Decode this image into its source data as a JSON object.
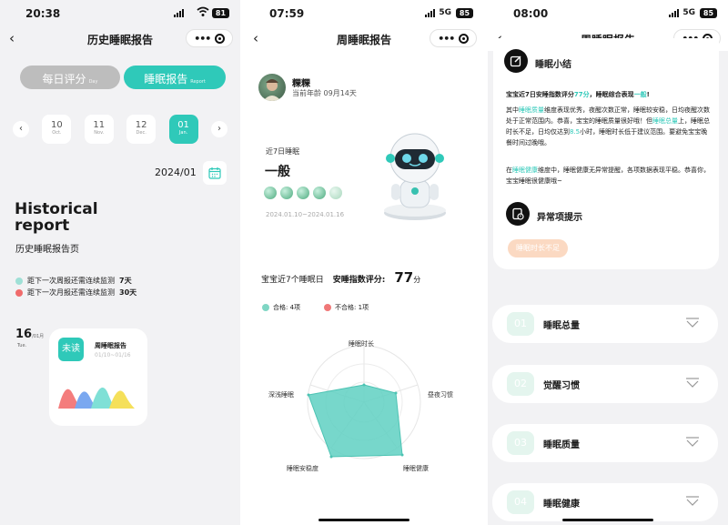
{
  "colors": {
    "accent": "#2fc9b9",
    "fail": "#f06b6b",
    "tab_inactive": "#bdbdbd",
    "warn_chip": "#fbd9c2"
  },
  "screen1": {
    "status": {
      "time": "20:38",
      "battery": "81"
    },
    "nav_title": "历史睡眠报告",
    "tabs": [
      {
        "label": "每日评分",
        "sub": "Day",
        "active": false
      },
      {
        "label": "睡眠报告",
        "sub": "Report",
        "active": true
      }
    ],
    "months": [
      {
        "num": "10",
        "abbr": "Oct."
      },
      {
        "num": "11",
        "abbr": "Nov."
      },
      {
        "num": "12",
        "abbr": "Dec."
      },
      {
        "num": "01",
        "abbr": "Jan."
      }
    ],
    "current_date": "2024/01",
    "title_en": "Historical report",
    "subtitle": "历史睡眠报告页",
    "legend": [
      {
        "text": "距下一次周报还需连续监测",
        "count": "7天"
      },
      {
        "text": "距下一次月报还需连续监测",
        "count": "30天"
      }
    ],
    "report_day": {
      "day": "16",
      "month": "/01月",
      "weekday": "Tue."
    },
    "report_card": {
      "badge": "未读",
      "title": "周睡眠报告",
      "range": "01/10~01/16"
    }
  },
  "screen2": {
    "status": {
      "time": "07:59",
      "network": "5G",
      "battery": "85"
    },
    "nav_title": "周睡眠报告",
    "user": {
      "name": "粿粿",
      "age": "当前年龄 09月14天"
    },
    "recent_label": "近7日睡眠",
    "verdict": "一般",
    "date_range": "2024.01.10~2024.01.16",
    "score": {
      "label": "宝宝近7个睡眠日",
      "name": "安睡指数评分:",
      "value": "77",
      "unit": "分"
    },
    "pass_fail": [
      {
        "label": "合格: 4项",
        "color": "#2fc9b9"
      },
      {
        "label": "不合格: 1项",
        "color": "#f06b6b"
      }
    ],
    "radar_labels": [
      "睡眠时长",
      "昼夜习惯",
      "睡眠健康",
      "睡眠安稳度",
      "深浅睡眠"
    ]
  },
  "screen3": {
    "status": {
      "time": "08:00",
      "network": "5G",
      "battery": "85"
    },
    "nav_title": "周睡眠报告",
    "summary_title": "睡眠小结",
    "summary_lead_a": "宝宝近7日安睡指数评分",
    "summary_lead_score": "77分",
    "summary_lead_b": "，睡眠综合表现",
    "summary_lead_level": "一般",
    "summary_lead_c": "!",
    "summary_p1_a": "其中",
    "summary_p1_hl1": "睡眠质量",
    "summary_p1_b": "维度表现优秀，夜醒次数正常，睡眠较安稳，日均夜醒次数处于正常范围内。恭喜，宝宝的睡眠质量很好哦！但",
    "summary_p1_hl2": "睡眠总量",
    "summary_p1_c": "上，睡眠总时长不足，日均仅达到",
    "summary_p1_hl3": "8.5",
    "summary_p1_d": "小时，睡眠时长低于建议范围。要避免宝宝晚餐时间过晚哦。",
    "summary_p2_a": "在",
    "summary_p2_hl": "睡眠健康",
    "summary_p2_b": "维度中，睡眠健康无异常提醒，各项数据表现平稳。恭喜你，宝宝睡眠很健康哦~",
    "alert_title": "异常项提示",
    "alert_chip": "睡眠时长不足",
    "sections": [
      {
        "num": "01",
        "label": "睡眠总量"
      },
      {
        "num": "02",
        "label": "觉醒习惯"
      },
      {
        "num": "03",
        "label": "睡眠质量"
      },
      {
        "num": "04",
        "label": "睡眠健康"
      }
    ]
  }
}
